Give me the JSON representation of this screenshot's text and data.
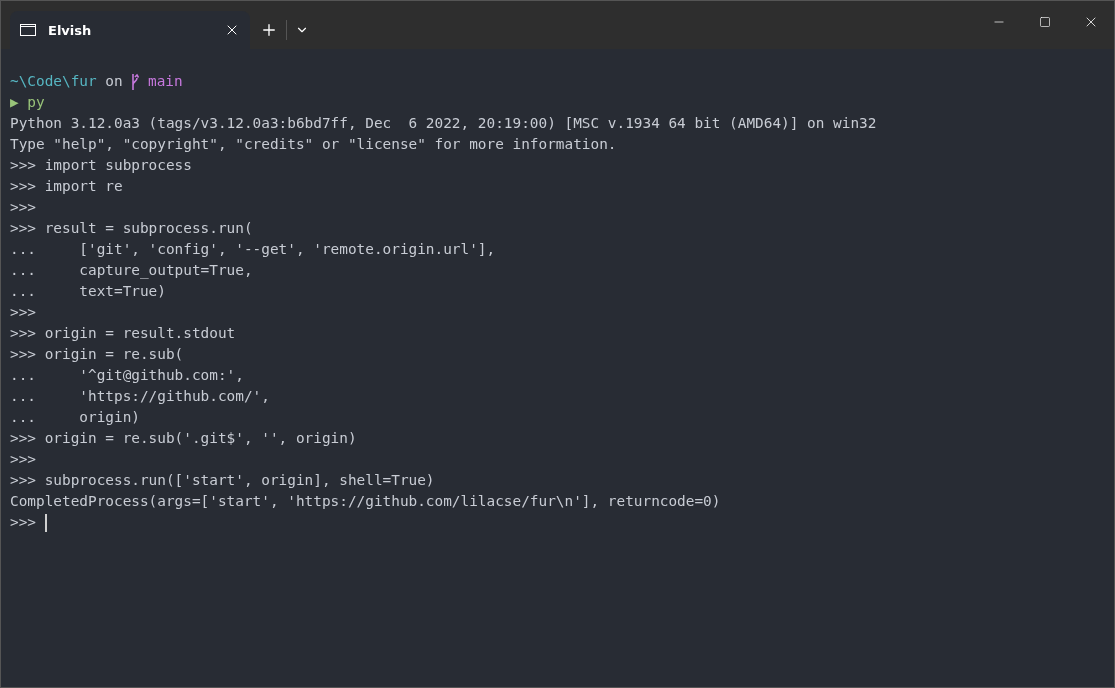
{
  "window": {
    "tabs": [
      {
        "title": "Elvish"
      }
    ]
  },
  "prompt": {
    "path": "~\\Code\\fur",
    "on": "on",
    "branch": "main",
    "marker": "▶",
    "command": "py"
  },
  "lines": [
    "Python 3.12.0a3 (tags/v3.12.0a3:b6bd7ff, Dec  6 2022, 20:19:00) [MSC v.1934 64 bit (AMD64)] on win32",
    "Type \"help\", \"copyright\", \"credits\" or \"license\" for more information.",
    ">>> import subprocess",
    ">>> import re",
    ">>>",
    ">>> result = subprocess.run(",
    "...     ['git', 'config', '--get', 'remote.origin.url'],",
    "...     capture_output=True,",
    "...     text=True)",
    ">>>",
    ">>> origin = result.stdout",
    ">>> origin = re.sub(",
    "...     '^git@github.com:',",
    "...     'https://github.com/',",
    "...     origin)",
    ">>> origin = re.sub('.git$', '', origin)",
    ">>>",
    ">>> subprocess.run(['start', origin], shell=True)",
    "CompletedProcess(args=['start', 'https://github.com/lilacse/fur\\n'], returncode=0)"
  ],
  "input_line": {
    "prompt": ">>>",
    "cursor": true
  }
}
